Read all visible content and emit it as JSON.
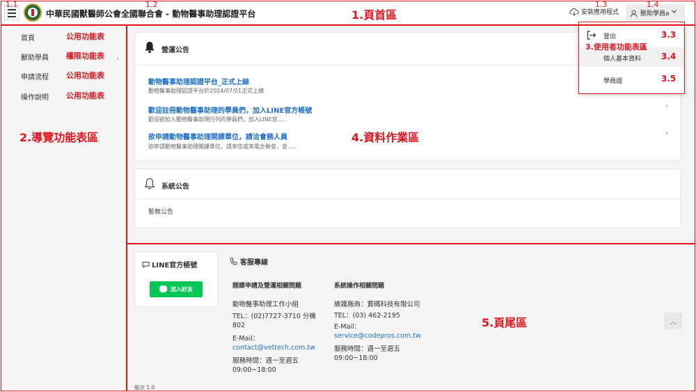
{
  "header": {
    "site_title": "中華民國獸醫師公會全國聯合會 - 動物醫事助理認證平台",
    "install_label": "安裝應用程式",
    "user_label": "獸助學員a"
  },
  "sidebar": {
    "items": [
      {
        "label": "首頁",
        "tag": "公用功能表"
      },
      {
        "label": "獸助學員",
        "tag": "權限功能表"
      },
      {
        "label": "申請流程",
        "tag": "公用功能表"
      },
      {
        "label": "操作說明",
        "tag": "公用功能表"
      }
    ]
  },
  "operation_card": {
    "title": "營運公告",
    "items": [
      {
        "title": "動物醫事助理認證平台_正式上線",
        "summary": "動物醫事助理認證平台於2024/07/01正式上線"
      },
      {
        "title": "歡迎註冊動物醫事助理的學員們，加入LINE官方帳號",
        "summary": "歡迎欲加入動物醫事助理行列的學員們，加入LINE官....."
      },
      {
        "title": "欲申請動物醫事助理開課單位，請洽會務人員",
        "summary": "欲申請動物醫事助理開課單位，請來信或來電全聯會，會....."
      }
    ]
  },
  "system_card": {
    "title": "系統公告",
    "empty_text": "暫無公告"
  },
  "user_menu": {
    "items": [
      {
        "label": "登出",
        "num": "3.3"
      },
      {
        "label": "個人基本資料",
        "num": "3.4"
      },
      {
        "label": "學員證",
        "num": "3.5"
      }
    ]
  },
  "footer": {
    "line_title": "LINE官方帳號",
    "line_button": "加入好友",
    "cs_title": "客服專線",
    "col1": {
      "title": "開課申請及營運相關問題",
      "lines": [
        "動物醫事助理工作小組",
        "TEL：(02)7727-3710 分機",
        "802",
        "E-Mail：",
        "contact@vettech.com.tw",
        "服務時間：週一至週五",
        "09:00~18:00"
      ]
    },
    "col2": {
      "title": "系統操作相關問題",
      "lines": [
        "維護廠商：寶碼科技有限公司",
        "TEL：(03) 462-2195",
        "E-Mail：",
        "service@codepros.com.tw",
        "服務時間：週一至週五",
        "09:00~18:00"
      ]
    },
    "version": "版次 1.0"
  },
  "annotations": {
    "a11": "1.1",
    "a12": "1.2",
    "a13": "1.3",
    "a14": "1.4",
    "header_region": "1.頁首區",
    "nav_region": "2.導覽功能表區",
    "user_region": "3.使用者功能表區",
    "data_region": "4.資料作業區",
    "footer_region": "5.頁尾區"
  },
  "colors": {
    "annotation": "#e0141e",
    "link": "#1e6fc7",
    "line_green": "#06c755"
  }
}
